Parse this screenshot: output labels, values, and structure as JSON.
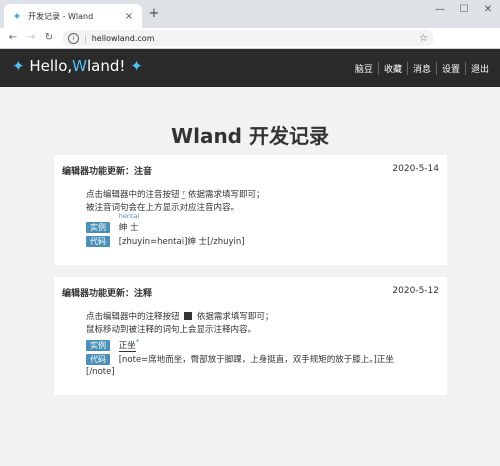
{
  "browser": {
    "tab_title": "开发记录 - Wland",
    "tab_close": "×",
    "new_tab": "+",
    "url": "hellowland.com",
    "win_min": "—",
    "win_max": "☐",
    "win_close": "✕"
  },
  "site": {
    "brand_hello": "Hello,",
    "brand_w": "W",
    "brand_rest": "land!",
    "nav": [
      "脑豆",
      "收藏",
      "消息",
      "设置",
      "退出"
    ]
  },
  "page": {
    "title": "Wland 开发记录"
  },
  "posts": [
    {
      "title": "编辑器功能更新：注音",
      "date": "2020-5-14",
      "line1_a": "点击编辑器中的注音按钮",
      "line1_b": "依据需求填写即可；",
      "line2": "被注音词句会在上方显示对应注音内容。",
      "example_tag": "实例",
      "example_ruby": "hentai",
      "example_text": "绅 士",
      "code_tag": "代码",
      "code_text": "[zhuyin=hentai]绅 士[/zhuyin]"
    },
    {
      "title": "编辑器功能更新：注释",
      "date": "2020-5-12",
      "line1_a": "点击编辑器中的注释按钮",
      "line1_b": "依据需求填写即可；",
      "line2": "鼠标移动到被注释的词句上会显示注释内容。",
      "example_tag": "实例",
      "example_text": "正坐",
      "example_mark": "*",
      "code_tag": "代码",
      "code_text": "[note=席地而坐，臀部放于脚踝，上身挺直，双手规矩的放于膝上。]正坐",
      "code_text2": "[/note]"
    }
  ]
}
